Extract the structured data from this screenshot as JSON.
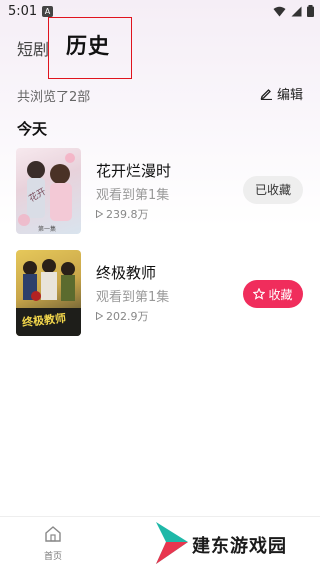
{
  "status_bar": {
    "time": "5:01",
    "notif_letter": "A"
  },
  "tabs": {
    "short": "短剧",
    "history": "历史"
  },
  "summary": "共浏览了2部",
  "edit_label": "编辑",
  "section_title": "今天",
  "dramas": [
    {
      "title": "花开烂漫时",
      "progress": "观看到第1集",
      "plays": "239.8万",
      "action": "已收藏",
      "poster_tag": "花开",
      "poster_caption": "第一集"
    },
    {
      "title": "终极教师",
      "progress": "观看到第1集",
      "plays": "202.9万",
      "action": "收藏",
      "poster_tag": "终极教师"
    }
  ],
  "bottom_nav": {
    "home_label": "首页"
  },
  "watermark": {
    "text": "建东游戏园"
  },
  "colors": {
    "accent": "#f02d5c",
    "highlight_box": "#e0141e"
  }
}
